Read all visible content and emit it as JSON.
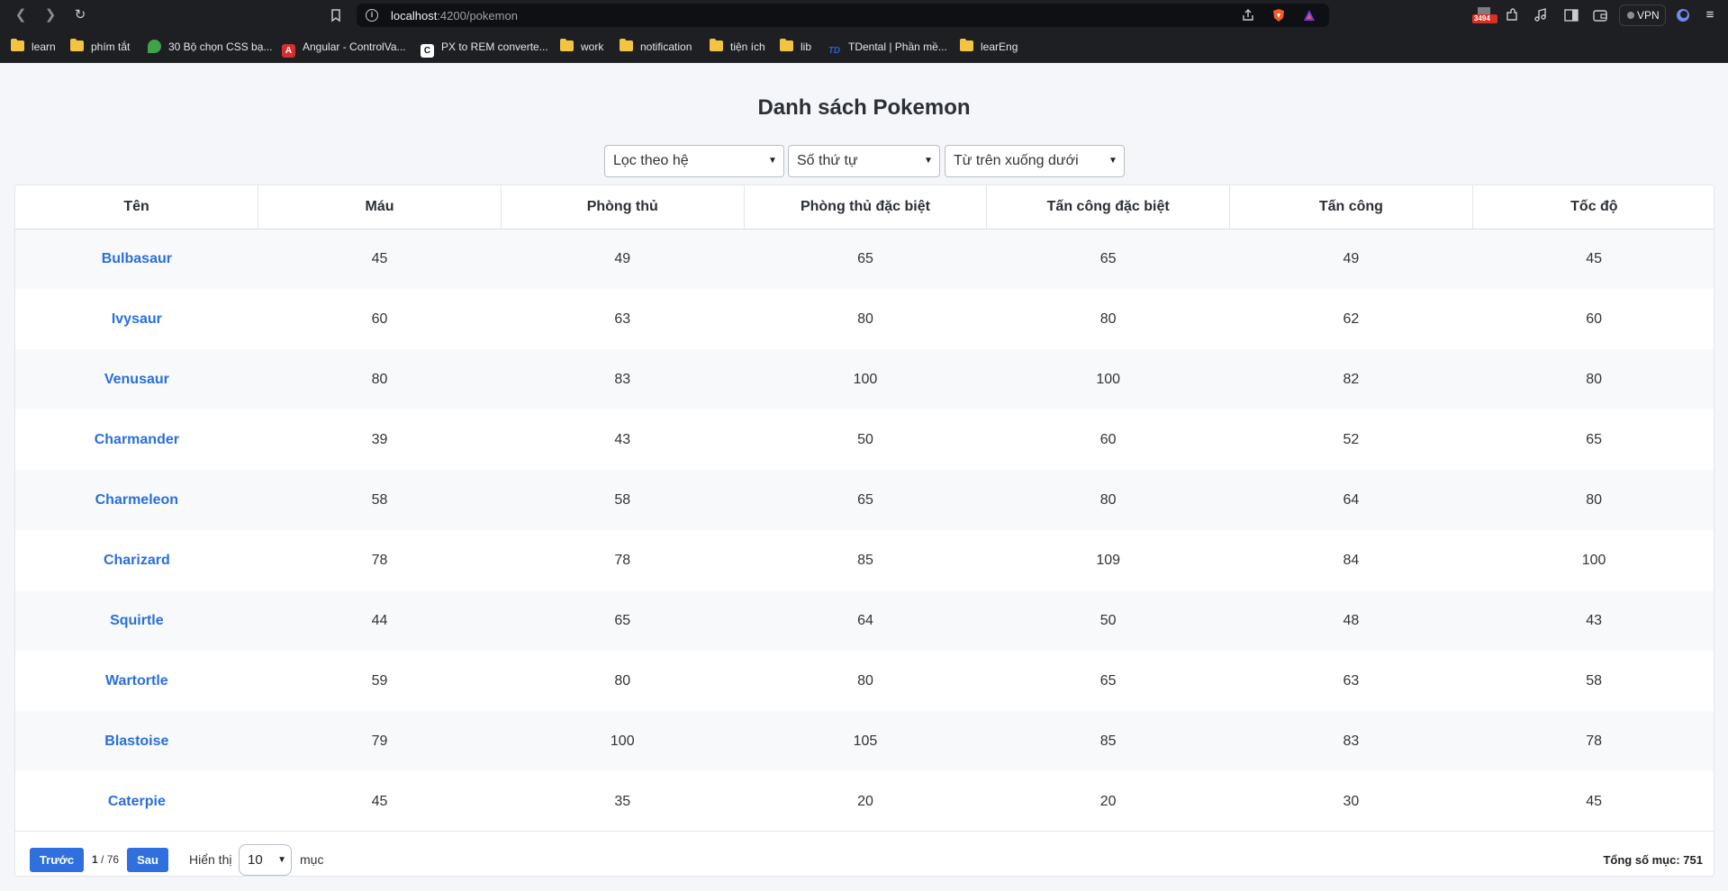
{
  "browser": {
    "url_host": "localhost",
    "url_rest": ":4200/pokemon",
    "vpn_label": "VPN",
    "badge_count": "3494",
    "bookmarks": [
      {
        "label": "learn",
        "icon": "folder-icon"
      },
      {
        "label": "phím tắt",
        "icon": "folder-icon"
      },
      {
        "label": "30 Bộ chọn CSS bạ...",
        "icon": "leaf-icon"
      },
      {
        "label": "Angular - ControlVa...",
        "icon": "angular-icon"
      },
      {
        "label": "PX to REM converte...",
        "icon": "c-icon"
      },
      {
        "label": "work",
        "icon": "folder-icon"
      },
      {
        "label": "notification",
        "icon": "folder-icon"
      },
      {
        "label": "tiện ích",
        "icon": "folder-icon"
      },
      {
        "label": "lib",
        "icon": "folder-icon"
      },
      {
        "label": "TDental | Phần mề...",
        "icon": "td-icon"
      },
      {
        "label": "learEng",
        "icon": "folder-icon"
      }
    ]
  },
  "page": {
    "title": "Danh sách Pokemon",
    "filters": {
      "generation": "Lọc theo hệ",
      "sort_by": "Số thứ tự",
      "order": "Từ trên xuống dưới"
    },
    "columns": [
      "Tên",
      "Máu",
      "Phòng thủ",
      "Phòng thủ đặc biệt",
      "Tấn công đặc biệt",
      "Tấn công",
      "Tốc độ"
    ],
    "rows": [
      [
        "Bulbasaur",
        "45",
        "49",
        "65",
        "65",
        "49",
        "45"
      ],
      [
        "Ivysaur",
        "60",
        "63",
        "80",
        "80",
        "62",
        "60"
      ],
      [
        "Venusaur",
        "80",
        "83",
        "100",
        "100",
        "82",
        "80"
      ],
      [
        "Charmander",
        "39",
        "43",
        "50",
        "60",
        "52",
        "65"
      ],
      [
        "Charmeleon",
        "58",
        "58",
        "65",
        "80",
        "64",
        "80"
      ],
      [
        "Charizard",
        "78",
        "78",
        "85",
        "109",
        "84",
        "100"
      ],
      [
        "Squirtle",
        "44",
        "65",
        "64",
        "50",
        "48",
        "43"
      ],
      [
        "Wartortle",
        "59",
        "80",
        "80",
        "65",
        "63",
        "58"
      ],
      [
        "Blastoise",
        "79",
        "100",
        "105",
        "85",
        "83",
        "78"
      ],
      [
        "Caterpie",
        "45",
        "35",
        "20",
        "20",
        "30",
        "45"
      ]
    ],
    "pagination": {
      "prev_label": "Trước",
      "current_page": "1",
      "separator": " / ",
      "total_pages": "76",
      "next_label": "Sau",
      "show_label": "Hiển thị",
      "page_size": "10",
      "unit_label": "mục",
      "total_label": "Tổng số mục: 751"
    }
  },
  "colors": {
    "accent": "#2f6fde",
    "link": "#2a6fdb",
    "row_alt": "#f7f9fb",
    "page_bg": "#f4f6f9"
  }
}
